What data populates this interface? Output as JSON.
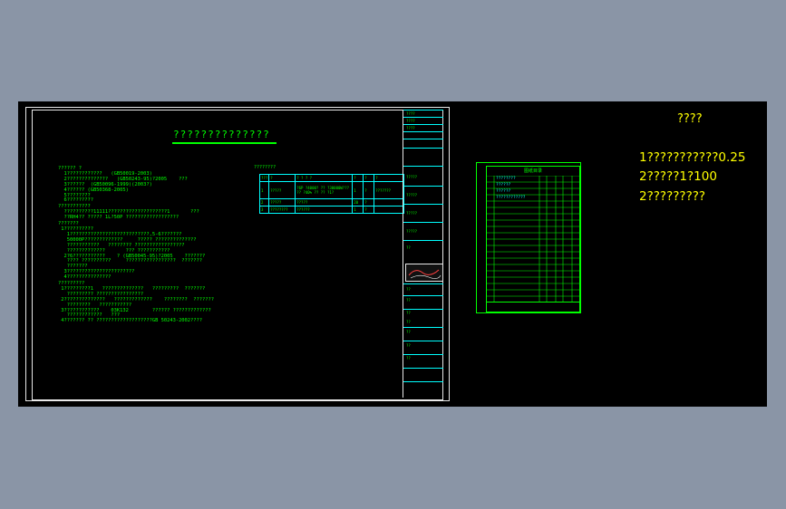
{
  "drawing": {
    "title": "??????????????",
    "notes_lines": [
      "?????? ?",
      "  1????????????   (GB50019-2003)",
      "  2??????????????   (GB50243-95)?2005    ???",
      "  3??????  (GB50096-1999)(2003?)",
      "  4?????? (GB50368-2005)",
      "  5????????",
      "  6?????????",
      "???????????",
      "  ??????????11111????????????????????1       ???",
      "  ??RH4?? ????? 1L?50P ??????????????????",
      "???????",
      " 1??????????",
      "   1???????????????????????????,5-6???????",
      "   50000P?????????????     ????? ??????????????",
      "   ???????????   ???????? ?????????????????",
      "   ?????????????       ??? ???????????",
      "  2?6???????????    ? (GB50045-95)?2005    ???????",
      "   ???? ??????????     ?????????????????  ???????",
      "   ???????",
      "  3???????????????????????",
      "  4???????????????",
      "?????????",
      " 1?????????1   ??????????????   ?????????  ???????",
      "   ????????? ????????????????",
      " 2??????????????   ?????????????    ????????  ???????",
      "   ????????   ???????????",
      " 3????????????    03K132        ?????? ?????????????",
      "   ????????????   ???",
      " 4??????? ?? ???????????????????GB 50243-2002????"
    ],
    "param_table_title": "????????",
    "param_table_header": [
      "???",
      "?",
      "? ? ? ?",
      "?",
      "?",
      "?"
    ],
    "param_table_rows": [
      [
        "1",
        "?????",
        "?6P ?4000? ?? ?30000W??? ??  ?40% ?? ?? ?1?",
        "1",
        "?",
        "???????"
      ],
      [
        "2",
        "?????",
        "?????",
        "20",
        "?",
        ""
      ],
      [
        "3",
        "????????",
        "??????",
        "1",
        "?",
        ""
      ]
    ],
    "title_block_labels": [
      "????",
      "????",
      "????",
      "?????",
      "?????",
      "?????",
      "?????",
      "??",
      "??",
      "??",
      "??",
      "??",
      "??",
      "??",
      "??"
    ]
  },
  "list_sheet": {
    "title": "图纸目录",
    "entries": [
      "????????",
      "??????",
      "??????",
      "????????????"
    ]
  },
  "right_notes": {
    "title": "????",
    "line1": "1???????????0.25",
    "line2": "2?????1?100",
    "line3": "2?????????"
  }
}
